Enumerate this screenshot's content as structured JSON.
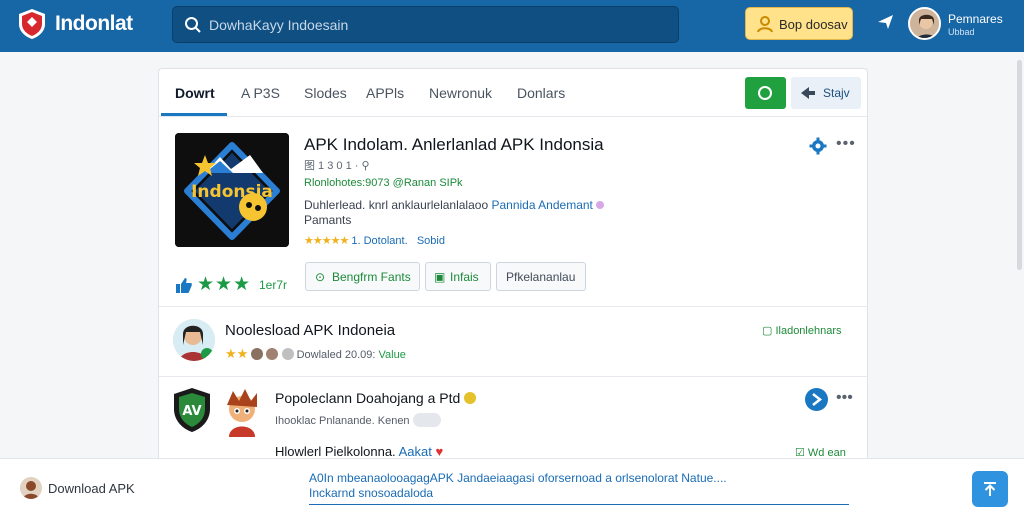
{
  "header": {
    "brand": "Indonlat",
    "search_placeholder": "DowhaKayy Indoesain",
    "download_label": "Bop doosav",
    "user_name": "Pemnares",
    "user_sub": "Ubbad"
  },
  "tabs": [
    {
      "label": "Dowrt"
    },
    {
      "label": "A P3S"
    },
    {
      "label": "Slodes"
    },
    {
      "label": "APPls"
    },
    {
      "label": "Newronuk"
    },
    {
      "label": "Donlars"
    }
  ],
  "tab_actions": {
    "stay_label": "Stajv"
  },
  "featured": {
    "title": "APK Indolam. Anlerlanlad APK Indonsia",
    "meta": "图 1 3 0 1 · ⚲",
    "dev": "Rlonlohotes:9073 @Ranan SIPk",
    "desc_1": "Duhlerlead. knrl anklaurlelanlalaoo",
    "desc_link": "Pannida Andemant",
    "desc_2": "Pamants",
    "rating_text": "1. Dotolant.",
    "rating_text2": "Sobid",
    "icon_text": "Indonsia",
    "rating_count": "1er7r",
    "chips": [
      "Bengfrm Fants",
      "Infais",
      "Pfkelananlau"
    ]
  },
  "list": [
    {
      "title": "Noolesload APK Indoneia",
      "meta": "Dowlaled 20.09:",
      "meta_tag": "Value",
      "tag": "Iladonlehnars"
    },
    {
      "title": "Popoleclann Doahojang a Ptd",
      "meta": "Ihooklac Pnlanande. Kenen",
      "sub_title": "Hlowlerl Pielkolonna.",
      "sub_link": "Aakat",
      "tag": "Wd ean"
    }
  ],
  "bottom": {
    "label": "Download APK",
    "text": "A0In mbeanaolooagagAPK Jandaeiaagasi oforsernoad a orlsenolorat Natue....\n Inckarnd snosoadaloda"
  },
  "colors": {
    "header": "#1766a6",
    "accent": "#1a78c2",
    "green": "#1d9a46",
    "star": "#f0b21a"
  }
}
